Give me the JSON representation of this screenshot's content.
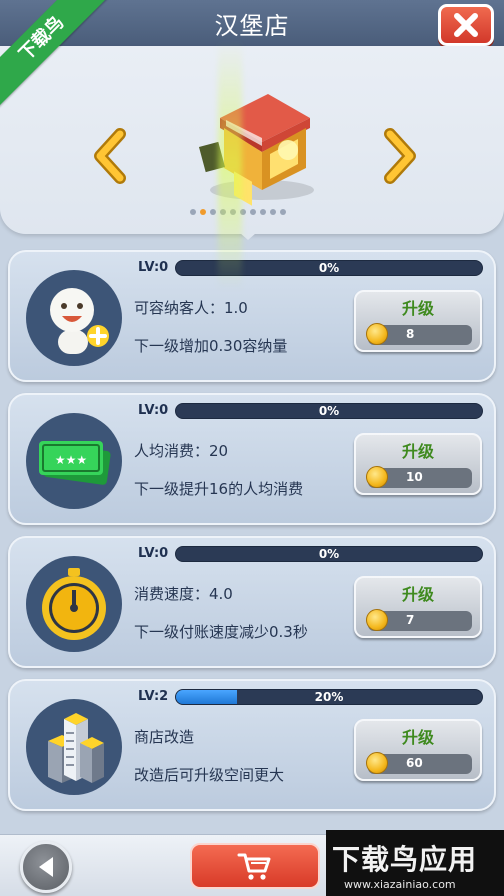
{
  "header": {
    "title": "汉堡店"
  },
  "ribbon": {
    "text": "下载鸟"
  },
  "showcase": {
    "page_count": 10,
    "active_page": 1
  },
  "cards": [
    {
      "level": "LV:0",
      "progress_text": "0%",
      "progress": 0.0,
      "line1": "可容纳客人：1.0",
      "line2": "下一级增加0.30容纳量",
      "upgrade_label": "升级",
      "cost": "8",
      "icon": "customer-face-plus-icon"
    },
    {
      "level": "LV:0",
      "progress_text": "0%",
      "progress": 0.0,
      "line1": "人均消费：20",
      "line2": "下一级提升16的人均消费",
      "upgrade_label": "升级",
      "cost": "10",
      "icon": "ticket-icon"
    },
    {
      "level": "LV:0",
      "progress_text": "0%",
      "progress": 0.0,
      "line1": "消费速度：4.0",
      "line2": "下一级付账速度减少0.3秒",
      "upgrade_label": "升级",
      "cost": "7",
      "icon": "stopwatch-icon"
    },
    {
      "level": "LV:2",
      "progress_text": "20%",
      "progress": 0.2,
      "line1": "商店改造",
      "line2": "改造后可升级空间更大",
      "upgrade_label": "升级",
      "cost": "60",
      "icon": "buildings-icon"
    }
  ],
  "watermark": {
    "main": "下载鸟应用",
    "sub": "www.xiazainiao.com"
  },
  "colors": {
    "accent_red": "#d83a28",
    "progress_blue": "#1f78d6",
    "upgrade_green": "#3f8a1f",
    "ribbon_green": "#2fa84a"
  }
}
